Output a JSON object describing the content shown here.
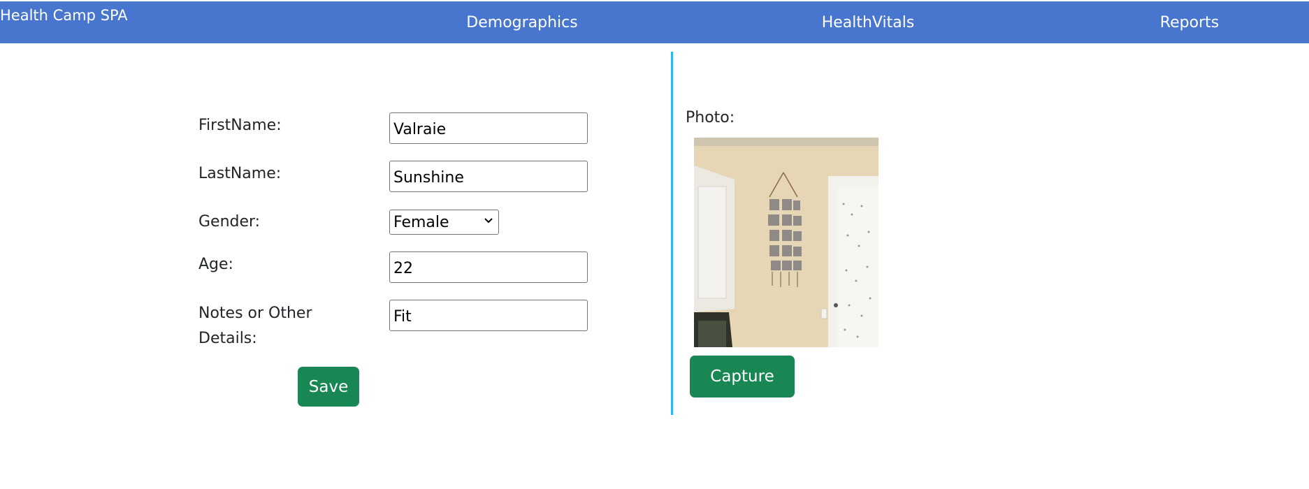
{
  "navbar": {
    "brand": "Health Camp SPA",
    "links": [
      "Demographics",
      "HealthVitals",
      "Reports"
    ]
  },
  "form": {
    "first_name_label": "FirstName:",
    "first_name_value": "Valraie",
    "last_name_label": "LastName:",
    "last_name_value": "Sunshine",
    "gender_label": "Gender:",
    "gender_value": "Female",
    "age_label": "Age:",
    "age_value": "22",
    "notes_label": "Notes or Other Details:",
    "notes_value": "Fit",
    "save_label": "Save"
  },
  "photo": {
    "label": "Photo:",
    "capture_label": "Capture"
  },
  "colors": {
    "navbar": "#4876cf",
    "button": "#198754",
    "divider": "#29b6f0"
  },
  "icons": {
    "gender_select": "chevron-down-icon"
  }
}
